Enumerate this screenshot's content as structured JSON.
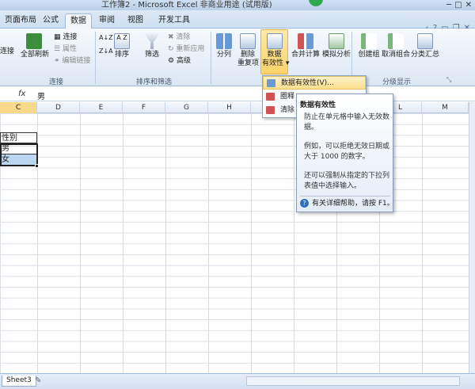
{
  "window": {
    "title": "工作簿2 - Microsoft Excel 非商业用途 (试用版)",
    "controls": [
      "─",
      "□",
      "✕"
    ]
  },
  "tabs": [
    "页面布局",
    "公式",
    "数据",
    "审阅",
    "视图",
    "开发工具"
  ],
  "active_tab": "数据",
  "ribbon": {
    "connections": {
      "refresh_all": "全部刷新",
      "connect": "连接",
      "connect_left": "连接",
      "properties": "属性",
      "edit_links": "编辑链接",
      "group": "连接"
    },
    "sort_filter": {
      "sort": "排序",
      "filter": "筛选",
      "clear": "清除",
      "reapply": "重新应用",
      "advanced": "高级",
      "group": "排序和筛选"
    },
    "data_tools": {
      "text_to_columns": "分列",
      "remove_duplicates_1": "删除",
      "remove_duplicates_2": "重复项",
      "validation_1": "数据",
      "validation_2": "有效性",
      "consolidate": "合并计算",
      "whatif": "模拟分析"
    },
    "outline": {
      "group_btn": "创建组",
      "ungroup": "取消组合",
      "subtotal": "分类汇总",
      "group": "分级显示"
    }
  },
  "formula_bar": {
    "fx": "fx",
    "value": "男"
  },
  "columns": [
    "C",
    "D",
    "E",
    "F",
    "G",
    "H",
    "I",
    "J",
    "K",
    "L",
    "M"
  ],
  "selected_column": "C",
  "cells": {
    "c1": "性别",
    "c2": "男",
    "c3": "女"
  },
  "dropdown": {
    "items": [
      "数据有效性(V)...",
      "圈释无效数据(I)",
      "清除无效数据标识圈(R)"
    ],
    "visible": [
      "数据有效性(V)...",
      "圈释",
      "清除"
    ]
  },
  "tooltip": {
    "title": "数据有效性",
    "p1": "防止在单元格中输入无效数据。",
    "p2": "例如，可以拒绝无效日期或大于 1000 的数字。",
    "p3": "还可以强制从指定的下拉列表值中选择输入。",
    "help": "有关详细帮助，请按 F1。"
  },
  "sheets": {
    "active": "Sheet3"
  },
  "colors": {
    "accent": "#2f6fbd",
    "highlight": "#fbd36a",
    "selection": "#bcd6f2"
  }
}
